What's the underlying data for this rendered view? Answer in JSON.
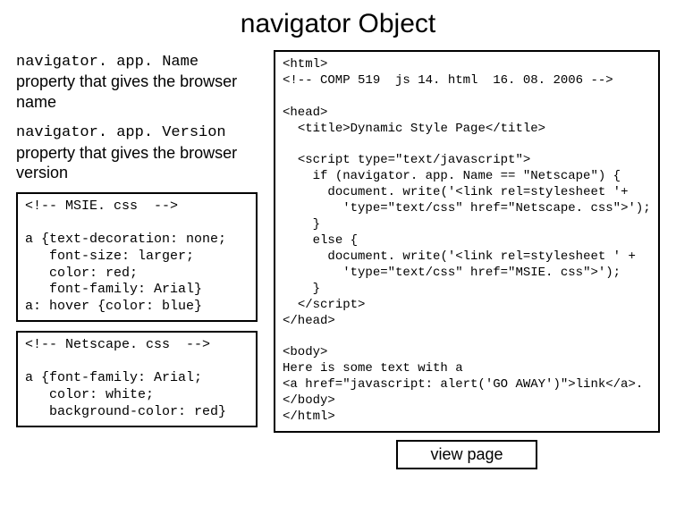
{
  "title": "navigator Object",
  "left": {
    "prop1_name": "navigator. app. Name",
    "prop1_desc": "property that gives the browser name",
    "prop2_name": "navigator. app. Version",
    "prop2_desc": "property that gives the browser version",
    "css1": "<!-- MSIE. css  -->\n\na {text-decoration: none;\n   font-size: larger;\n   color: red;\n   font-family: Arial}\na: hover {color: blue}",
    "css2": "<!-- Netscape. css  -->\n\na {font-family: Arial;\n   color: white;\n   background-color: red}"
  },
  "right": {
    "code": "<html>\n<!-- COMP 519  js 14. html  16. 08. 2006 -->\n\n<head>\n  <title>Dynamic Style Page</title>\n\n  <script type=\"text/javascript\">\n    if (navigator. app. Name == \"Netscape\") {\n      document. write('<link rel=stylesheet '+\n        'type=\"text/css\" href=\"Netscape. css\">');\n    }\n    else {\n      document. write('<link rel=stylesheet ' +\n        'type=\"text/css\" href=\"MSIE. css\">');\n    }\n  </script>\n</head>\n\n<body>\nHere is some text with a\n<a href=\"javascript: alert('GO AWAY')\">link</a>.\n</body>\n</html>",
    "view_label": "view page"
  }
}
